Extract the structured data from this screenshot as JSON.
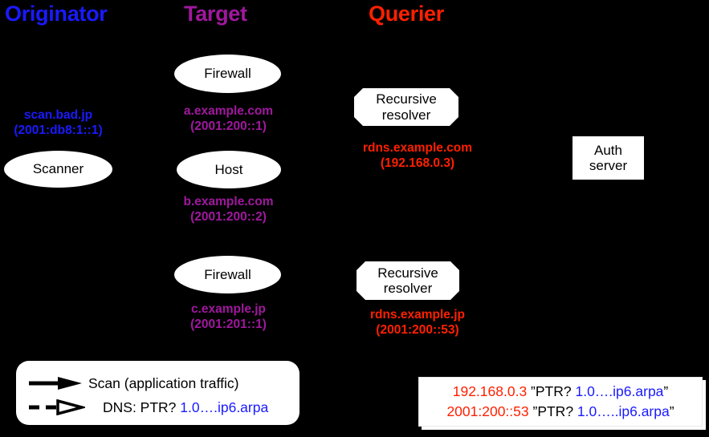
{
  "diagram": {
    "title": "DNS reverse-lookup scan diagram",
    "background": "#000000"
  },
  "colors": {
    "originator": "#1a1aff",
    "target": "#a0189e",
    "querier": "#ff2000",
    "node_fill": "#ffffff",
    "node_text": "#000000",
    "arpa_blue": "#1a1aff"
  },
  "columns": [
    {
      "id": "originator",
      "label": "Originator",
      "color": "#1a1aff"
    },
    {
      "id": "target",
      "label": "Target",
      "color": "#a0189e"
    },
    {
      "id": "querier",
      "label": "Querier",
      "color": "#ff2000"
    }
  ],
  "nodes": {
    "scanner": {
      "label": "Scanner",
      "shape": "ellipse"
    },
    "firewall_a": {
      "label": "Firewall",
      "shape": "ellipse"
    },
    "host_b": {
      "label": "Host",
      "shape": "ellipse"
    },
    "firewall_c": {
      "label": "Firewall",
      "shape": "ellipse"
    },
    "resolver_com": {
      "label_line1": "Recursive",
      "label_line2": "resolver",
      "shape": "octagon"
    },
    "resolver_jp": {
      "label_line1": "Recursive",
      "label_line2": "resolver",
      "shape": "octagon"
    },
    "auth_server": {
      "label_line1": "Auth",
      "label_line2": "server",
      "shape": "rect"
    }
  },
  "captions": {
    "scanner": {
      "name": "scan.bad.jp",
      "address": "(2001:db8:1::1)",
      "color": "#1a1aff"
    },
    "firewall_a": {
      "name": "a.example.com",
      "address": "(2001:200::1)",
      "color": "#a0189e"
    },
    "host_b": {
      "name": "b.example.com",
      "address": "(2001:200::2)",
      "color": "#a0189e"
    },
    "firewall_c": {
      "name": "c.example.jp",
      "address": "(2001:201::1)",
      "color": "#a0189e"
    },
    "resolver_com": {
      "name": "rdns.example.com",
      "address": "(192.168.0.3)",
      "color": "#ff2000"
    },
    "resolver_jp": {
      "name": "rdns.example.jp",
      "address": "(2001:200::53)",
      "color": "#ff2000"
    }
  },
  "legend": {
    "rows": [
      {
        "id": "scan",
        "arrow": "solid-filled-arrow",
        "text": "Scan (application traffic)",
        "arpa": ""
      },
      {
        "id": "dns",
        "arrow": "dashed-hollow-arrow",
        "text": "DNS: PTR? ",
        "arpa": "1.0….ip6.arpa"
      }
    ]
  },
  "query_box": {
    "lines": [
      {
        "address": "192.168.0.3",
        "quote_open": " ”PTR? ",
        "arpa": "1.0….ip6.arpa",
        "quote_close": "”"
      },
      {
        "address": "2001:200::53",
        "quote_open": " ”PTR? ",
        "arpa": "1.0…..ip6.arpa",
        "quote_close": "”"
      }
    ]
  }
}
